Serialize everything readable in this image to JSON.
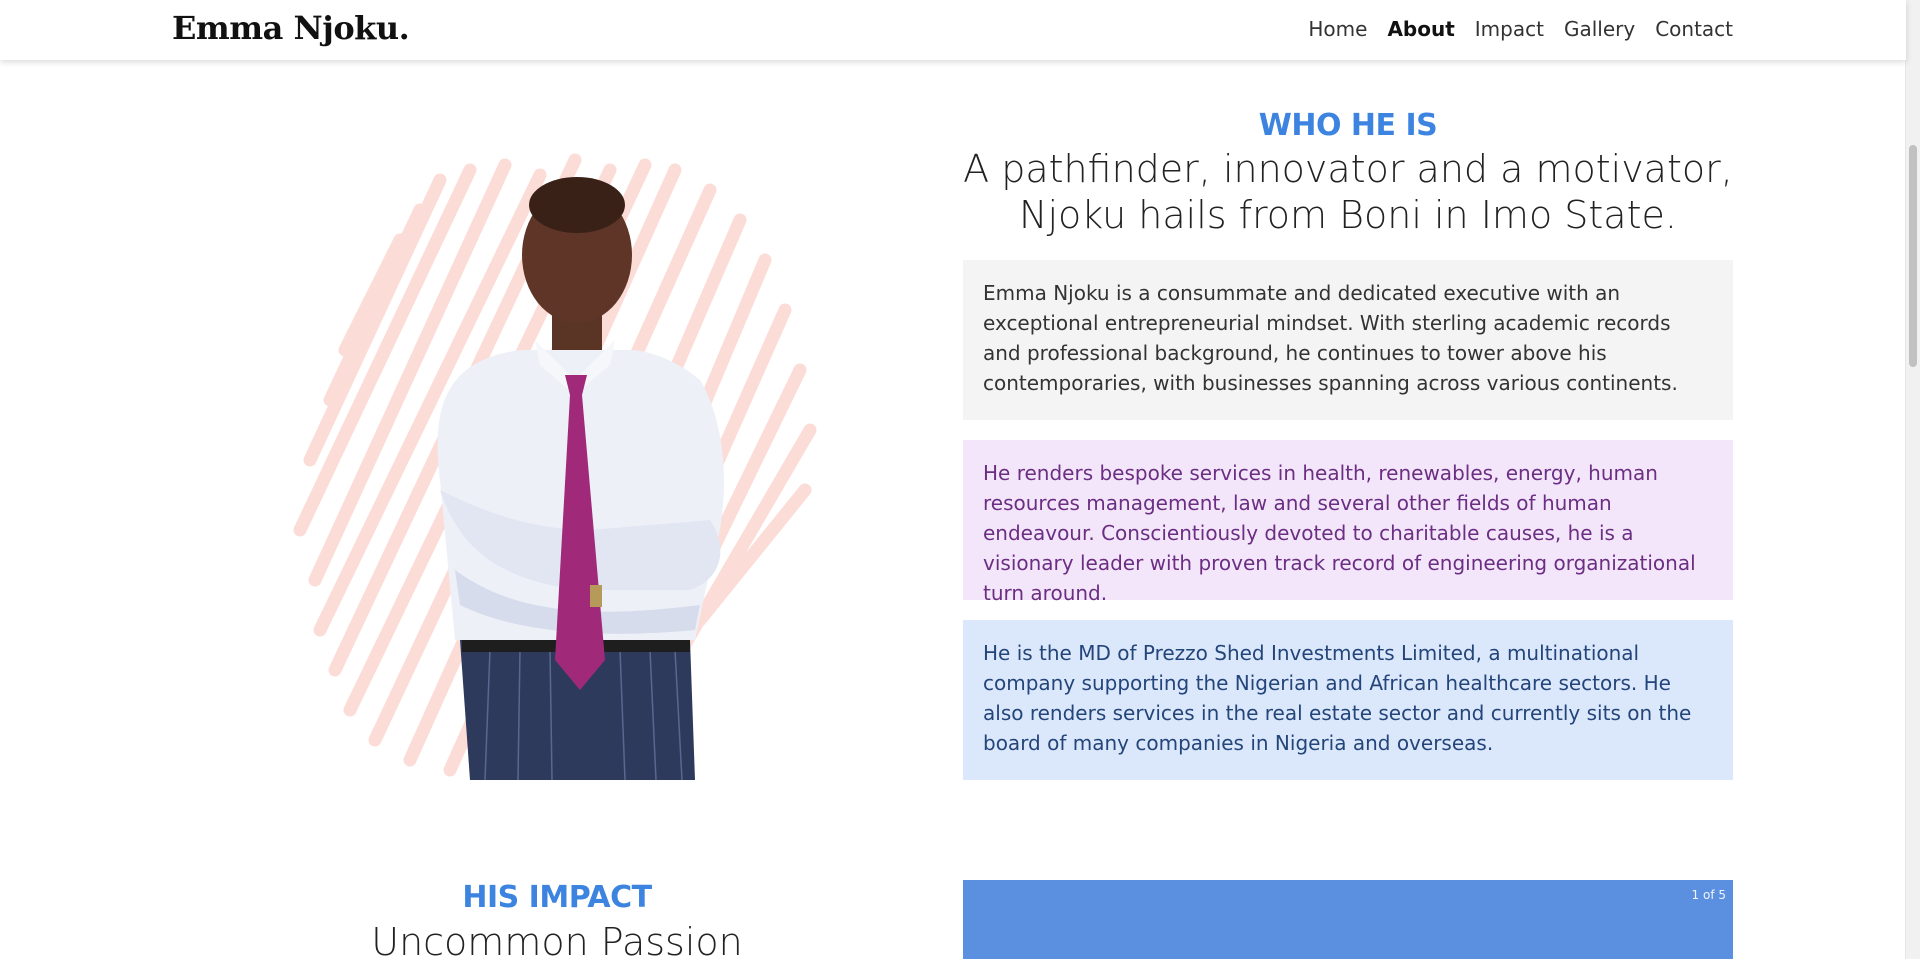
{
  "header": {
    "brand": "Emma Njoku.",
    "nav": [
      "Home",
      "About",
      "Impact",
      "Gallery",
      "Contact"
    ],
    "active_nav": "About"
  },
  "about": {
    "label": "WHO HE IS",
    "headline": "A pathfinder, innovator and a motivator, Njoku hails from Boni in Imo State.",
    "paragraphs": [
      "Emma Njoku is a consummate and dedicated executive with an exceptional entrepreneurial mindset. With sterling academic records and professional background, he continues to tower above his contemporaries, with businesses spanning across various continents.",
      "He renders bespoke services in health, renewables, energy, human resources management, law and several other fields of human endeavour. Conscientiously devoted to charitable causes, he is a visionary leader with proven track record of engineering organizational turn around.",
      "He is the MD of Prezzo Shed Investments Limited, a multinational company supporting the Nigerian and African healthcare sectors. He also renders services in the real estate sector and currently sits on the board of many companies in Nigeria and overseas."
    ]
  },
  "impact": {
    "label": "HIS IMPACT",
    "headline": "Uncommon Passion",
    "slider_counter": "1 of 5"
  },
  "colors": {
    "accent": "#3c84e0",
    "card_grey": "#f4f4f4",
    "card_purple": "#f3e6fa",
    "card_blue": "#dbe8fb",
    "slider_bg": "#5b90e0"
  }
}
